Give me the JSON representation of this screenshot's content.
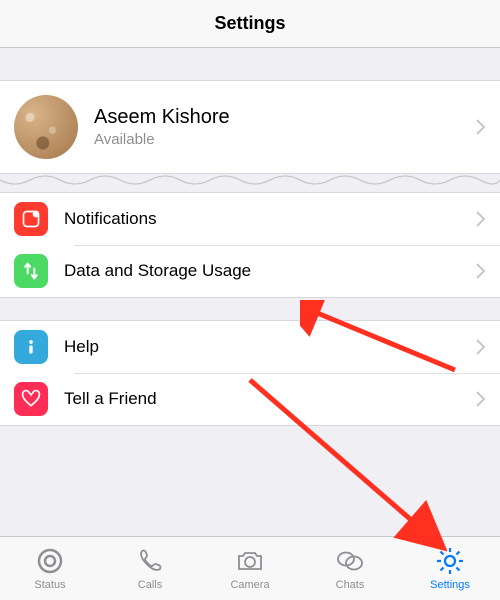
{
  "header": {
    "title": "Settings"
  },
  "profile": {
    "name": "Aseem Kishore",
    "status": "Available"
  },
  "group1": {
    "items": [
      {
        "label": "Notifications",
        "icon": "notifications-icon",
        "color": "red"
      },
      {
        "label": "Data and Storage Usage",
        "icon": "data-usage-icon",
        "color": "green"
      }
    ]
  },
  "group2": {
    "items": [
      {
        "label": "Help",
        "icon": "help-icon",
        "color": "blue"
      },
      {
        "label": "Tell a Friend",
        "icon": "tell-friend-icon",
        "color": "pink"
      }
    ]
  },
  "tabs": [
    {
      "label": "Status",
      "icon": "status-icon"
    },
    {
      "label": "Calls",
      "icon": "calls-icon"
    },
    {
      "label": "Camera",
      "icon": "camera-icon"
    },
    {
      "label": "Chats",
      "icon": "chats-icon"
    },
    {
      "label": "Settings",
      "icon": "settings-icon",
      "active": true
    }
  ]
}
